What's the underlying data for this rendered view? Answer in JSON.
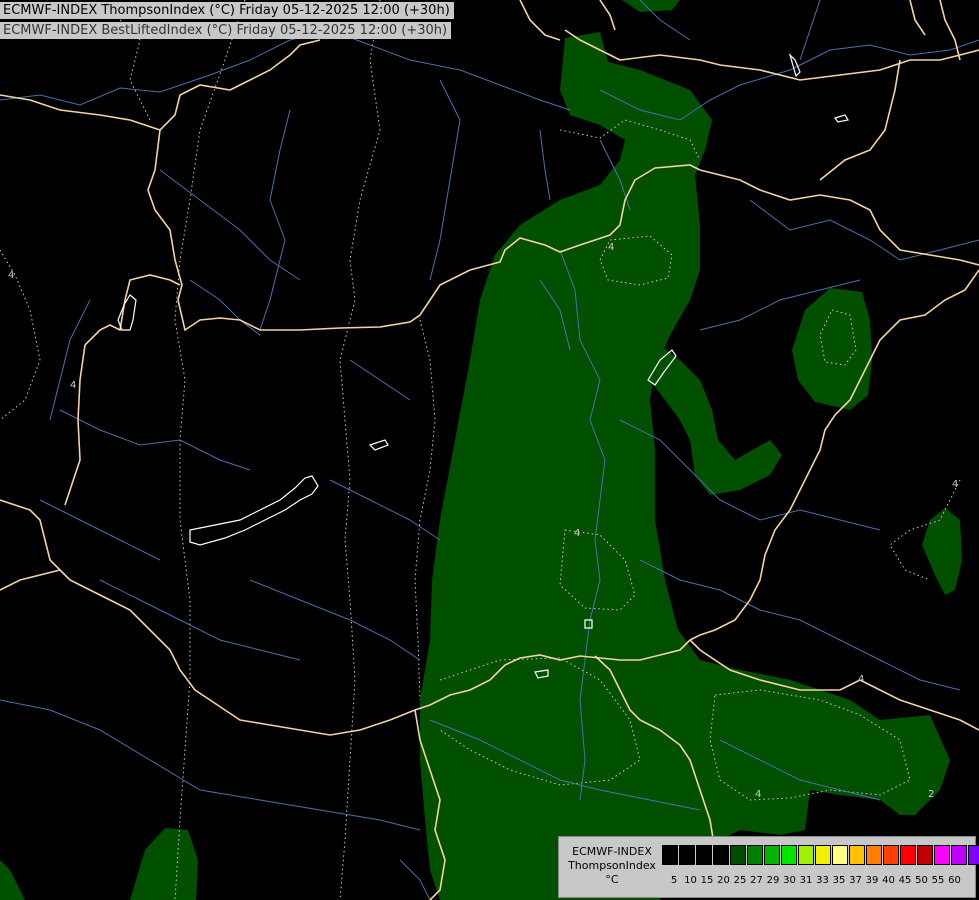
{
  "header": {
    "title_line1": "ECMWF-INDEX ThompsonIndex (°C) Friday 05-12-2025 12:00 (+30h)",
    "title_line2": "ECMWF-INDEX BestLiftedIndex (°C) Friday 05-12-2025 12:00 (+30h)"
  },
  "legend": {
    "line1": "ECMWF-INDEX",
    "line2": "ThompsonIndex",
    "line3": "°C",
    "colors": [
      "#000000",
      "#000000",
      "#000000",
      "#000000",
      "#004d00",
      "#008000",
      "#00b400",
      "#00e600",
      "#a0f000",
      "#f0f000",
      "#ffff80",
      "#ffc000",
      "#ff8000",
      "#ff4000",
      "#ff0000",
      "#c00000",
      "#ff00ff",
      "#c000ff",
      "#8000ff",
      "#4000ff",
      "#0000ff"
    ],
    "labels": [
      "5",
      "10",
      "15",
      "20",
      "25",
      "27",
      "29",
      "30",
      "31",
      "33",
      "35",
      "37",
      "39",
      "40",
      "45",
      "50",
      "55",
      "60"
    ]
  },
  "map": {
    "contour_labels": [
      "4",
      "4",
      "4",
      "4",
      "4",
      "4",
      "4",
      "2"
    ],
    "field_color": "#005000",
    "border_color": "#f5d3a0",
    "river_color": "#4a6fb0",
    "lake_color": "#ffffff",
    "contour_color": "#cccccc"
  }
}
